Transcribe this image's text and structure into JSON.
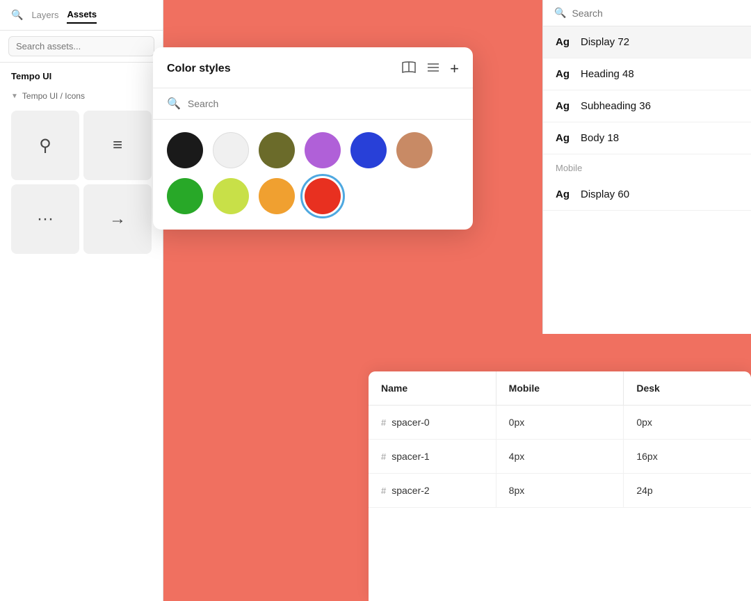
{
  "sidebar": {
    "search_icon": "🔍",
    "tabs": [
      {
        "label": "Layers",
        "active": false
      },
      {
        "label": "Assets",
        "active": true
      }
    ],
    "search_placeholder": "Search assets...",
    "section_title": "Tempo UI",
    "subsection": "Tempo UI / Icons",
    "icons": [
      {
        "symbol": "⌕",
        "type": "search"
      },
      {
        "symbol": "≡",
        "type": "menu"
      },
      {
        "symbol": "···",
        "type": "more"
      },
      {
        "symbol": "→",
        "type": "arrow"
      }
    ]
  },
  "color_panel": {
    "title": "Color styles",
    "search_placeholder": "Search",
    "icons": {
      "book": "📖",
      "list": "☰",
      "plus": "+"
    },
    "swatches_row1": [
      {
        "color": "#1a1a1a",
        "name": "black",
        "selected": false
      },
      {
        "color": "#f0f0f0",
        "name": "white",
        "selected": false
      },
      {
        "color": "#5a5a2a",
        "name": "olive",
        "selected": false
      },
      {
        "color": "#c070e0",
        "name": "purple",
        "selected": false
      },
      {
        "color": "#3050e0",
        "name": "blue",
        "selected": false
      },
      {
        "color": "#c08060",
        "name": "brown",
        "selected": false
      }
    ],
    "swatches_row2": [
      {
        "color": "#30a030",
        "name": "green",
        "selected": false
      },
      {
        "color": "#c0e050",
        "name": "yellow-green",
        "selected": false
      },
      {
        "color": "#f0a040",
        "name": "orange",
        "selected": false
      },
      {
        "color": "#e83020",
        "name": "red",
        "selected": true
      }
    ]
  },
  "text_panel": {
    "search_placeholder": "Search",
    "section_desktop": null,
    "styles": [
      {
        "ag": "Ag",
        "name": "Display 72",
        "highlighted": true
      },
      {
        "ag": "Ag",
        "name": "Heading 48",
        "highlighted": false
      },
      {
        "ag": "Ag",
        "name": "Subheading 36",
        "highlighted": false
      },
      {
        "ag": "Ag",
        "name": "Body 18",
        "highlighted": false
      }
    ],
    "section_mobile": "Mobile",
    "mobile_styles": [
      {
        "ag": "Ag",
        "name": "Display 60",
        "highlighted": false
      }
    ]
  },
  "table": {
    "columns": [
      {
        "label": "Name"
      },
      {
        "label": "Mobile"
      },
      {
        "label": "Desk"
      }
    ],
    "rows": [
      {
        "name": "spacer-0",
        "mobile": "0px",
        "desktop": "0px"
      },
      {
        "name": "spacer-1",
        "mobile": "4px",
        "desktop": "16px"
      },
      {
        "name": "spacer-2",
        "mobile": "8px",
        "desktop": "24p"
      }
    ]
  }
}
